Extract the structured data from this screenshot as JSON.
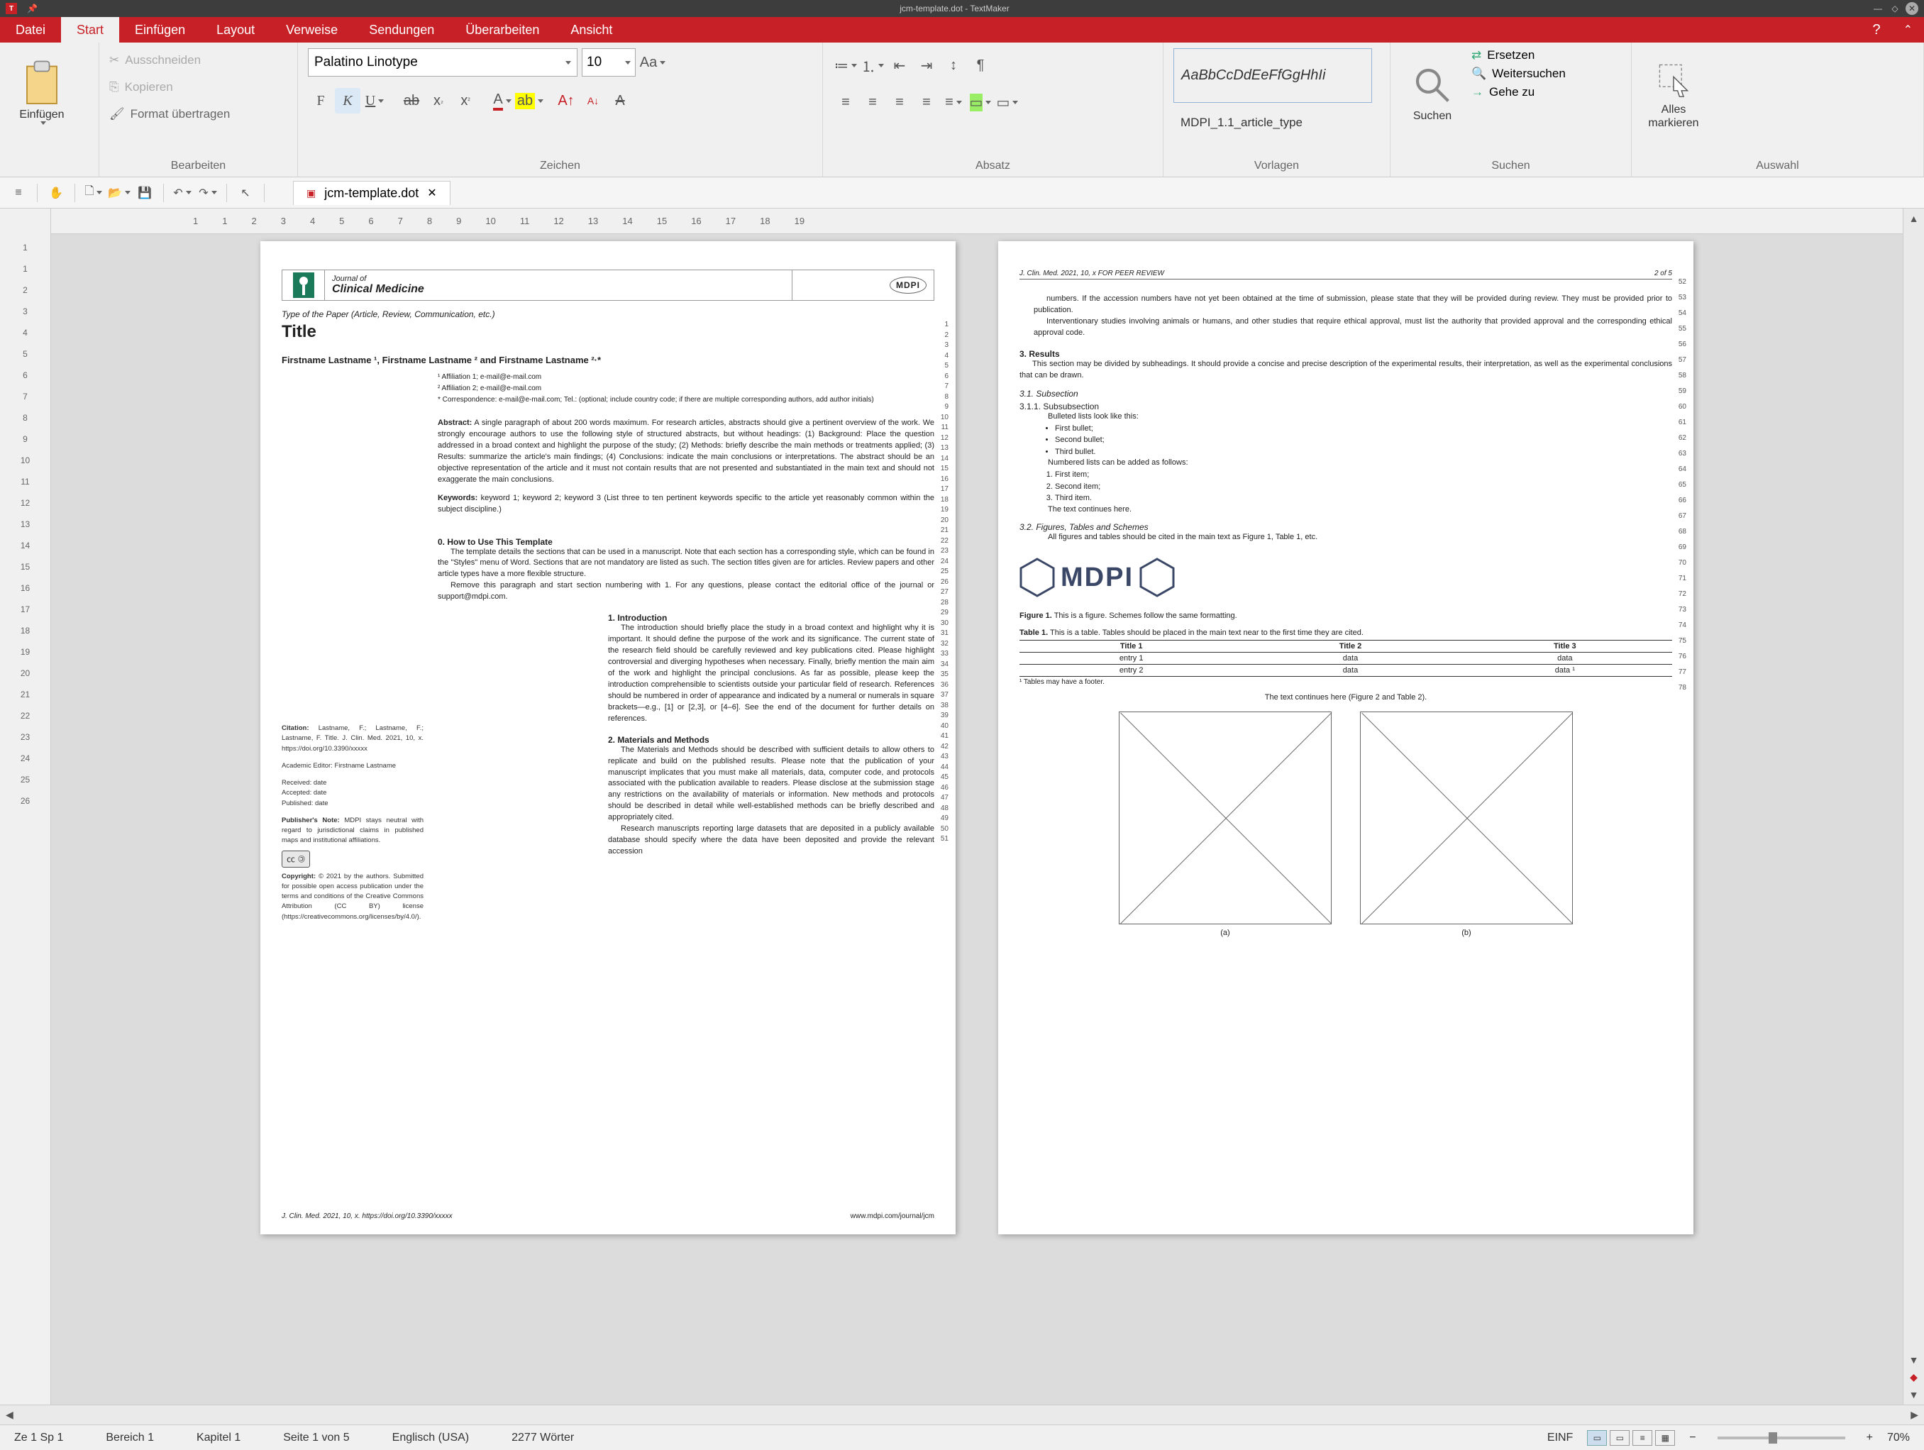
{
  "app": {
    "title": "jcm-template.dot - TextMaker",
    "icon_letter": "T"
  },
  "menus": {
    "items": [
      "Datei",
      "Start",
      "Einfügen",
      "Layout",
      "Verweise",
      "Sendungen",
      "Überarbeiten",
      "Ansicht"
    ],
    "active": "Start"
  },
  "ribbon": {
    "insert": {
      "label": "Einfügen"
    },
    "edit": {
      "group_label": "Bearbeiten",
      "cut": "Ausschneiden",
      "copy": "Kopieren",
      "paste_format": "Format übertragen"
    },
    "character": {
      "group_label": "Zeichen",
      "font": "Palatino Linotype",
      "size": "10"
    },
    "paragraph": {
      "group_label": "Absatz"
    },
    "styles": {
      "group_label": "Vorlagen",
      "preview": "AaBbCcDdEeFfGgHhIi",
      "name": "MDPI_1.1_article_type"
    },
    "search": {
      "group_label": "Suchen",
      "big": "Suchen",
      "replace": "Ersetzen",
      "continue": "Weitersuchen",
      "goto": "Gehe zu"
    },
    "select": {
      "group_label": "Auswahl",
      "label": "Alles markieren"
    }
  },
  "doc_tab": {
    "name": "jcm-template.dot"
  },
  "hruler": [
    "1",
    "1",
    "2",
    "3",
    "4",
    "5",
    "6",
    "7",
    "8",
    "9",
    "10",
    "11",
    "12",
    "13",
    "14",
    "15",
    "16",
    "17",
    "18",
    "19"
  ],
  "vruler": [
    "1",
    "1",
    "2",
    "3",
    "4",
    "5",
    "6",
    "7",
    "8",
    "9",
    "10",
    "11",
    "12",
    "13",
    "14",
    "15",
    "16",
    "17",
    "18",
    "19",
    "20",
    "21",
    "22",
    "23",
    "24",
    "25",
    "26"
  ],
  "page1": {
    "journal_of": "Journal of",
    "journal_name": "Clinical Medicine",
    "mdpi": "MDPI",
    "type_line": "Type of the Paper (Article, Review, Communication, etc.)",
    "title": "Title",
    "authors": "Firstname Lastname ¹, Firstname Lastname ² and Firstname Lastname ²·*",
    "aff1": "¹  Affiliation 1; e-mail@e-mail.com",
    "aff2": "²  Affiliation 2; e-mail@e-mail.com",
    "corr": "*  Correspondence: e-mail@e-mail.com; Tel.: (optional; include country code; if there are multiple corresponding authors, add author initials)",
    "abstract_label": "Abstract:",
    "abstract": "A single paragraph of about 200 words maximum. For research articles, abstracts should give a pertinent overview of the work. We strongly encourage authors to use the following style of structured abstracts, but without headings: (1) Background: Place the question addressed in a broad context and highlight the purpose of the study; (2) Methods: briefly describe the main methods or treatments applied; (3) Results: summarize the article's main findings; (4) Conclusions: indicate the main conclusions or interpretations. The abstract should be an objective representation of the article and it must not contain results that are not presented and substantiated in the main text and should not exaggerate the main conclusions.",
    "keywords_label": "Keywords:",
    "keywords": "keyword 1; keyword 2; keyword 3 (List three to ten pertinent keywords specific to the article yet reasonably common within the subject discipline.)",
    "h0": "0. How to Use This Template",
    "p0a": "The template details the sections that can be used in a manuscript. Note that each section has a corresponding style, which can be found in the \"Styles\" menu of Word. Sections that are not mandatory are listed as such. The section titles given are for articles. Review papers and other article types have a more flexible structure.",
    "p0b": "Remove this paragraph and start section numbering with 1. For any questions, please contact the editorial office of the journal or support@mdpi.com.",
    "h1": "1. Introduction",
    "p1": "The introduction should briefly place the study in a broad context and highlight why it is important. It should define the purpose of the work and its significance. The current state of the research field should be carefully reviewed and key publications cited. Please highlight controversial and diverging hypotheses when necessary. Finally, briefly mention the main aim of the work and highlight the principal conclusions. As far as possible, please keep the introduction comprehensible to scientists outside your particular field of research. References should be numbered in order of appearance and indicated by a numeral or numerals in square brackets—e.g., [1] or [2,3], or [4–6]. See the end of the document for further details on references.",
    "h2": "2. Materials and Methods",
    "p2a": "The Materials and Methods should be described with sufficient details to allow others to replicate and build on the published results. Please note that the publication of your manuscript implicates that you must make all materials, data, computer code, and protocols associated with the publication available to readers. Please disclose at the submission stage any restrictions on the availability of materials or information. New methods and protocols should be described in detail while well-established methods can be briefly described and appropriately cited.",
    "p2b": "Research manuscripts reporting large datasets that are deposited in a publicly available database should specify where the data have been deposited and provide the relevant accession",
    "side_citation_label": "Citation:",
    "side_citation": "Lastname, F.; Lastname, F.; Lastname, F. Title. J. Clin. Med. 2021, 10, x. https://doi.org/10.3390/xxxxx",
    "side_editor": "Academic Editor: Firstname Lastname",
    "side_received": "Received: date",
    "side_accepted": "Accepted: date",
    "side_published": "Published: date",
    "side_pubnote_label": "Publisher's Note:",
    "side_pubnote": "MDPI stays neutral with regard to jurisdictional claims in published maps and institutional affiliations.",
    "side_copyright_label": "Copyright:",
    "side_copyright": "© 2021 by the authors. Submitted for possible open access publication under the terms and conditions of the Creative Commons Attribution (CC BY) license (https://creativecommons.org/licenses/by/4.0/).",
    "foot_left": "J. Clin. Med. 2021, 10, x. https://doi.org/10.3390/xxxxx",
    "foot_right": "www.mdpi.com/journal/jcm",
    "line_nums": [
      "1",
      "2",
      "3",
      "4",
      "5",
      "6",
      "7",
      "8",
      "9",
      "10",
      "11",
      "12",
      "13",
      "14",
      "15",
      "16",
      "17",
      "18",
      "19",
      "20",
      "21",
      "22",
      "23",
      "24",
      "25",
      "26",
      "27",
      "28",
      "29",
      "30",
      "31",
      "32",
      "33",
      "34",
      "35",
      "36",
      "37",
      "38",
      "39",
      "40",
      "41",
      "42",
      "43",
      "44",
      "45",
      "46",
      "47",
      "48",
      "49",
      "50",
      "51"
    ]
  },
  "page2": {
    "head_left": "J. Clin. Med. 2021, 10, x FOR PEER REVIEW",
    "head_right": "2 of 5",
    "p_cont": "numbers. If the accession numbers have not yet been obtained at the time of submission, please state that they will be provided during review. They must be provided prior to publication.",
    "p_cont2": "Interventionary studies involving animals or humans, and other studies that require ethical approval, must list the authority that provided approval and the corresponding ethical approval code.",
    "h3": "3. Results",
    "p3": "This section may be divided by subheadings. It should provide a concise and precise description of the experimental results, their interpretation, as well as the experimental conclusions that can be drawn.",
    "h31": "3.1. Subsection",
    "h311": "3.1.1. Subsubsection",
    "bullet_intro": "Bulleted lists look like this:",
    "b1": "First bullet;",
    "b2": "Second bullet;",
    "b3": "Third bullet.",
    "num_intro": "Numbered lists can be added as follows:",
    "n1": "First item;",
    "n2": "Second item;",
    "n3": "Third item.",
    "continues": "The text continues here.",
    "h32": "3.2. Figures, Tables and Schemes",
    "p32": "All figures and tables should be cited in the main text as Figure 1, Table 1, etc.",
    "fig_label": "Figure 1.",
    "fig_cap": "This is a figure. Schemes follow the same formatting.",
    "tab_label": "Table 1.",
    "tab_cap": "This is a table. Tables should be placed in the main text near to the first time they are cited.",
    "th1": "Title 1",
    "th2": "Title 2",
    "th3": "Title 3",
    "r1c1": "entry 1",
    "r1c2": "data",
    "r1c3": "data",
    "r2c1": "entry 2",
    "r2c2": "data",
    "r2c3": "data ¹",
    "tbl_foot": "¹ Tables may have a footer.",
    "continues2": "The text continues here (Figure 2 and Table 2).",
    "cap_a": "(a)",
    "cap_b": "(b)",
    "line_nums": [
      "52",
      "53",
      "54",
      "55",
      "56",
      "57",
      "58",
      "59",
      "60",
      "61",
      "62",
      "63",
      "64",
      "65",
      "66",
      "67",
      "68",
      "69",
      "70",
      "71",
      "72",
      "73",
      "74",
      "75",
      "76",
      "77",
      "78"
    ]
  },
  "status": {
    "pos": "Ze 1 Sp 1",
    "section": "Bereich 1",
    "chapter": "Kapitel 1",
    "page": "Seite 1 von 5",
    "lang": "Englisch (USA)",
    "words": "2277 Wörter",
    "mode": "EINF",
    "zoom": "70%"
  }
}
